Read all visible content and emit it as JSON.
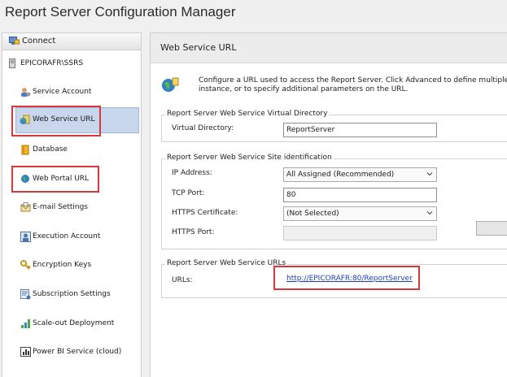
{
  "app": {
    "title": "Report Server Configuration Manager"
  },
  "sidebar": {
    "connect_label": "Connect",
    "server_name": "EPICORAFR\\SSRS",
    "items": [
      {
        "label": "Service Account",
        "icon": "service-account-icon"
      },
      {
        "label": "Web Service URL",
        "icon": "web-service-icon",
        "selected": true
      },
      {
        "label": "Database",
        "icon": "database-icon"
      },
      {
        "label": "Web Portal URL",
        "icon": "globe-icon"
      },
      {
        "label": "E-mail Settings",
        "icon": "email-icon"
      },
      {
        "label": "Execution Account",
        "icon": "execution-account-icon"
      },
      {
        "label": "Encryption Keys",
        "icon": "key-icon"
      },
      {
        "label": "Subscription Settings",
        "icon": "subscription-icon"
      },
      {
        "label": "Scale-out Deployment",
        "icon": "scale-out-icon"
      },
      {
        "label": "Power BI Service (cloud)",
        "icon": "powerbi-icon"
      }
    ]
  },
  "main": {
    "header": "Web Service URL",
    "description_line1": "Configure a URL used to access the Report Server.  Click Advanced to define multiple URLs for a s",
    "description_line2": "instance, or to specify additional parameters on the URL.",
    "virtual_directory": {
      "group_title": "Report Server Web Service Virtual Directory",
      "label": "Virtual Directory:",
      "value": "ReportServer"
    },
    "site_identification": {
      "group_title": "Report Server Web Service Site identification",
      "ip_label": "IP Address:",
      "ip_value": "All Assigned (Recommended)",
      "tcp_label": "TCP Port:",
      "tcp_value": "80",
      "https_cert_label": "HTTPS Certificate:",
      "https_cert_value": "(Not Selected)",
      "https_port_label": "HTTPS Port:",
      "https_port_value": ""
    },
    "urls": {
      "group_title": "Report Server Web Service URLs",
      "label": "URLs:",
      "link": "http://EPICORAFR:80/ReportServer"
    }
  },
  "colors": {
    "highlight": "#d9363e",
    "selection": "#c8d7ec",
    "link": "#1a3fbf"
  }
}
